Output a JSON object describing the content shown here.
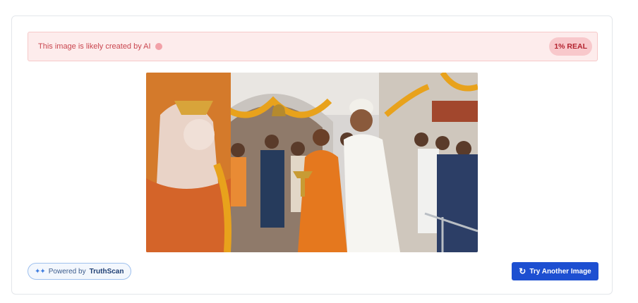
{
  "alert": {
    "message": "This image is likely created by AI",
    "badge": "1% REAL"
  },
  "image": {
    "description_icon": "photo"
  },
  "footer": {
    "powered_prefix": "Powered by",
    "powered_brand": "TruthScan",
    "try_another_label": "Try Another Image"
  },
  "icons": {
    "info": "info-dot-icon",
    "sparkle": "sparkle-icon",
    "refresh": "refresh-icon"
  },
  "colors": {
    "alert_bg": "#fdecec",
    "alert_text": "#c9464f",
    "badge_bg": "#f8c8cb",
    "badge_text": "#b4232f",
    "primary_button": "#1d4fd1",
    "powered_border": "#9ec0ee"
  }
}
